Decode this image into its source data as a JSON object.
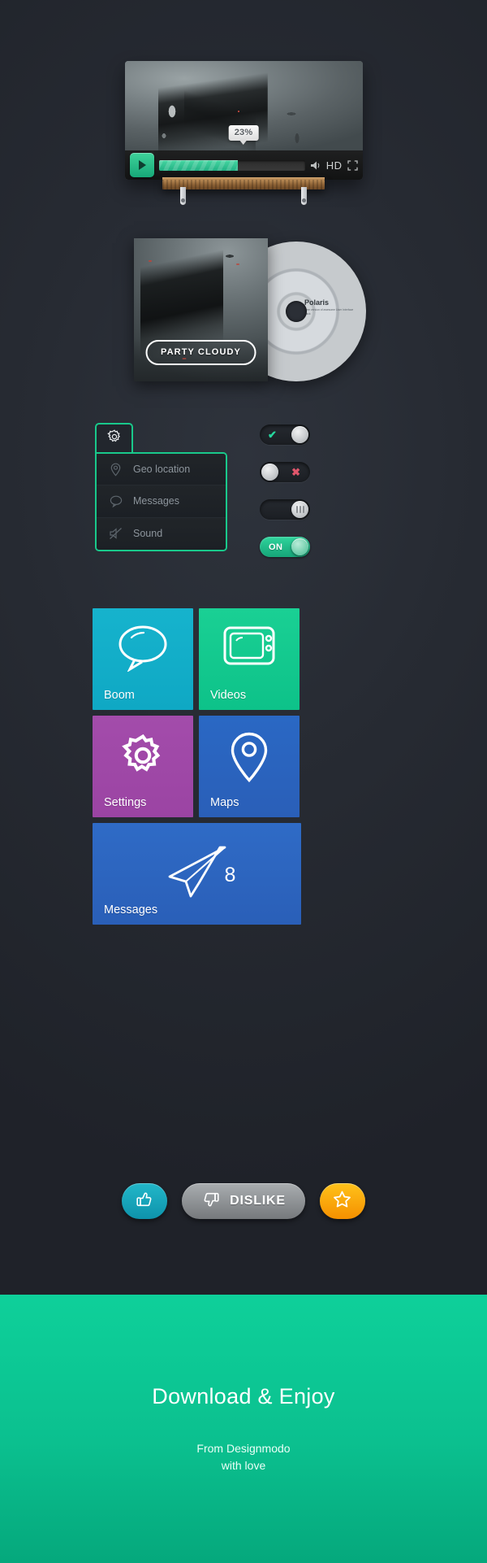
{
  "player": {
    "progress_label": "23%",
    "progress_percent": 23,
    "play_icon": "play-icon",
    "volume_icon": "volume-icon",
    "hd_label": "HD",
    "fullscreen_icon": "fullscreen-icon"
  },
  "album": {
    "cover_button_label": "PARTY CLOUDY",
    "disc_title": "Polaris",
    "disc_subtitle": "Free version of awesome User Interface Pack"
  },
  "settings_menu": {
    "gear_icon": "gear-icon",
    "items": [
      {
        "label": "Geo location",
        "icon": "location-pin-icon"
      },
      {
        "label": "Messages",
        "icon": "chat-bubble-icon"
      },
      {
        "label": "Sound",
        "icon": "sound-muted-icon"
      }
    ]
  },
  "toggles": [
    {
      "name": "toggle-check",
      "state": "on",
      "mark": "✔",
      "mark_color": "#26d79e",
      "knob": "right"
    },
    {
      "name": "toggle-cross",
      "state": "off",
      "mark": "✖",
      "mark_color": "#e0566b",
      "knob": "left"
    },
    {
      "name": "toggle-grip",
      "state": "off",
      "mark": "",
      "mark_color": "",
      "knob": "right"
    },
    {
      "name": "toggle-on",
      "state": "on",
      "mark": "ON",
      "mark_color": "#ffffff",
      "knob": "right"
    }
  ],
  "tiles": [
    {
      "label": "Boom",
      "icon": "chat-bubble-icon",
      "color": "#12aec8",
      "size": "small"
    },
    {
      "label": "Videos",
      "icon": "tv-icon",
      "color": "#14c68c",
      "size": "small"
    },
    {
      "label": "Settings",
      "icon": "gear-icon",
      "color": "#9e48a6",
      "size": "small"
    },
    {
      "label": "Maps",
      "icon": "location-pin-icon",
      "color": "#2a63bd",
      "size": "small"
    },
    {
      "label": "Messages",
      "icon": "paper-plane-icon",
      "color": "#2c65bf",
      "size": "wide",
      "badge": "8"
    }
  ],
  "actions": {
    "like_icon": "thumbs-up-icon",
    "dislike_icon": "thumbs-down-icon",
    "dislike_label": "DISLIKE",
    "star_icon": "star-icon"
  },
  "footer": {
    "title": "Download & Enjoy",
    "line1": "From Designmodo",
    "line2": "with love"
  },
  "colors": {
    "accent_green": "#0ec08f",
    "background": "#272b33"
  }
}
